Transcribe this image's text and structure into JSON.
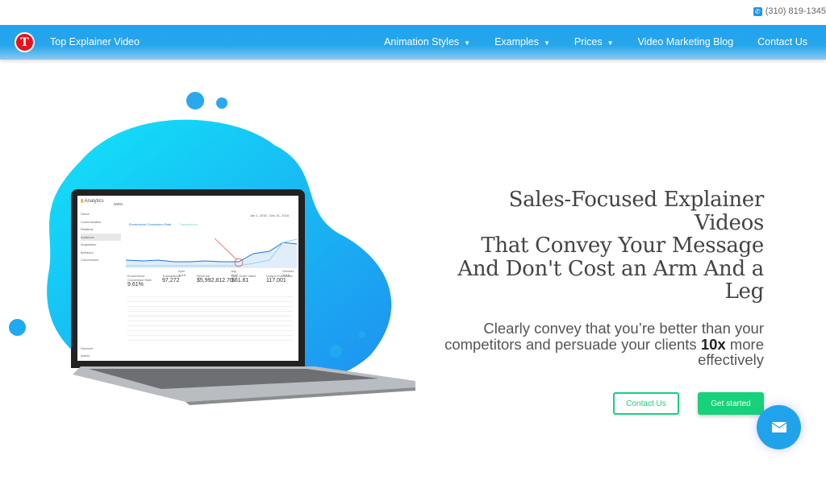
{
  "topbar": {
    "phone": "(310) 819-1345",
    "phone_icon": "phone-icon"
  },
  "nav": {
    "brand": "Top Explainer Video",
    "logo_letter": "T",
    "items": [
      {
        "label": "Animation Styles",
        "dropdown": true
      },
      {
        "label": "Examples",
        "dropdown": true
      },
      {
        "label": "Prices",
        "dropdown": true
      },
      {
        "label": "Video Marketing Blog",
        "dropdown": false
      },
      {
        "label": "Contact Us",
        "dropdown": false
      }
    ]
  },
  "hero": {
    "headline": [
      "Sales-Focused Explainer",
      "Videos",
      "That Convey Your Message",
      "And Don't Cost an Arm And a",
      "Leg"
    ],
    "sub_before": "Clearly convey that you’re better than your competitors and persuade your clients ",
    "sub_bold": "10x",
    "sub_after": " more effectively",
    "contact_label": "Contact Us",
    "start_label": "Get started"
  },
  "analytics": {
    "title": "Analytics",
    "site": "www.",
    "date_range": "Jan 1, 2018 - Dec 31, 2018",
    "sidebar": [
      "Home",
      "Customization",
      "Realtime",
      "Audience",
      "Acquisition",
      "Behavior",
      "Conversions",
      "Discover",
      "Admin"
    ],
    "legend": [
      "Ecommerce Conversion Rate",
      "Transactions"
    ],
    "metrics": [
      {
        "label": "Ecommerce Conversion Rate",
        "value": "9.61%"
      },
      {
        "label": "Transactions",
        "value": "97,272"
      },
      {
        "label": "Revenue",
        "value": "$5,992,812.70"
      },
      {
        "label": "Avg. Order Value",
        "value": "$61.61"
      },
      {
        "label": "Unique Purchases",
        "value": "117,001"
      }
    ],
    "axis": [
      "April 2018",
      "July 2018",
      "October 2018"
    ]
  },
  "colors": {
    "nav": "#22a2ec",
    "accent_green": "#17d27a",
    "logo_red": "#e8121c",
    "blob": "#1ec8f5"
  }
}
